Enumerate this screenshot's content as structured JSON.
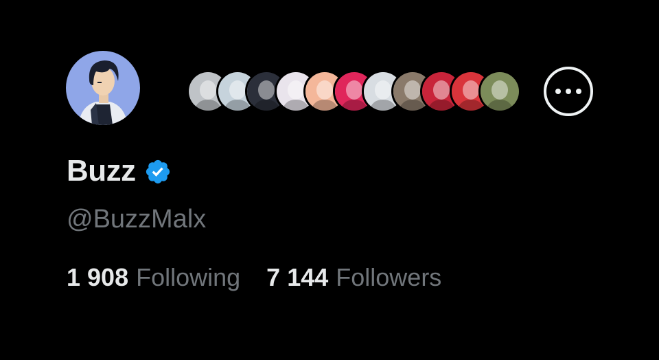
{
  "profile": {
    "display_name": "Buzz",
    "handle": "@BuzzMalx",
    "verified": true,
    "avatar_icon": "anime-boy-avatar"
  },
  "mutual_followers": [
    {
      "icon": "gray-sketch-avatar",
      "bg": "#bfc3c7"
    },
    {
      "icon": "green-hair-avatar",
      "bg": "#c6d3dc"
    },
    {
      "icon": "robot-cat-avatar",
      "bg": "#2b2f3a"
    },
    {
      "icon": "pink-hair-avatar",
      "bg": "#e9e4ec"
    },
    {
      "icon": "fox-avatar",
      "bg": "#f4b79a"
    },
    {
      "icon": "blue-bird-avatar",
      "bg": "#e0265b"
    },
    {
      "icon": "white-creature-avatar",
      "bg": "#d8dde2"
    },
    {
      "icon": "glasses-man-avatar",
      "bg": "#8a7a6a"
    },
    {
      "icon": "red-anime-avatar",
      "bg": "#c8243a"
    },
    {
      "icon": "sunglasses-avatar",
      "bg": "#d9343b"
    },
    {
      "icon": "purple-hair-avatar",
      "bg": "#7c8c5a"
    }
  ],
  "more_button_icon": "more-options-icon",
  "stats": {
    "following_count": "1 908",
    "following_label": "Following",
    "followers_count": "7 144",
    "followers_label": "Followers"
  },
  "colors": {
    "background": "#000000",
    "primary_text": "#e7e9ea",
    "secondary_text": "#71767b",
    "verified_blue": "#1d9bf0"
  }
}
